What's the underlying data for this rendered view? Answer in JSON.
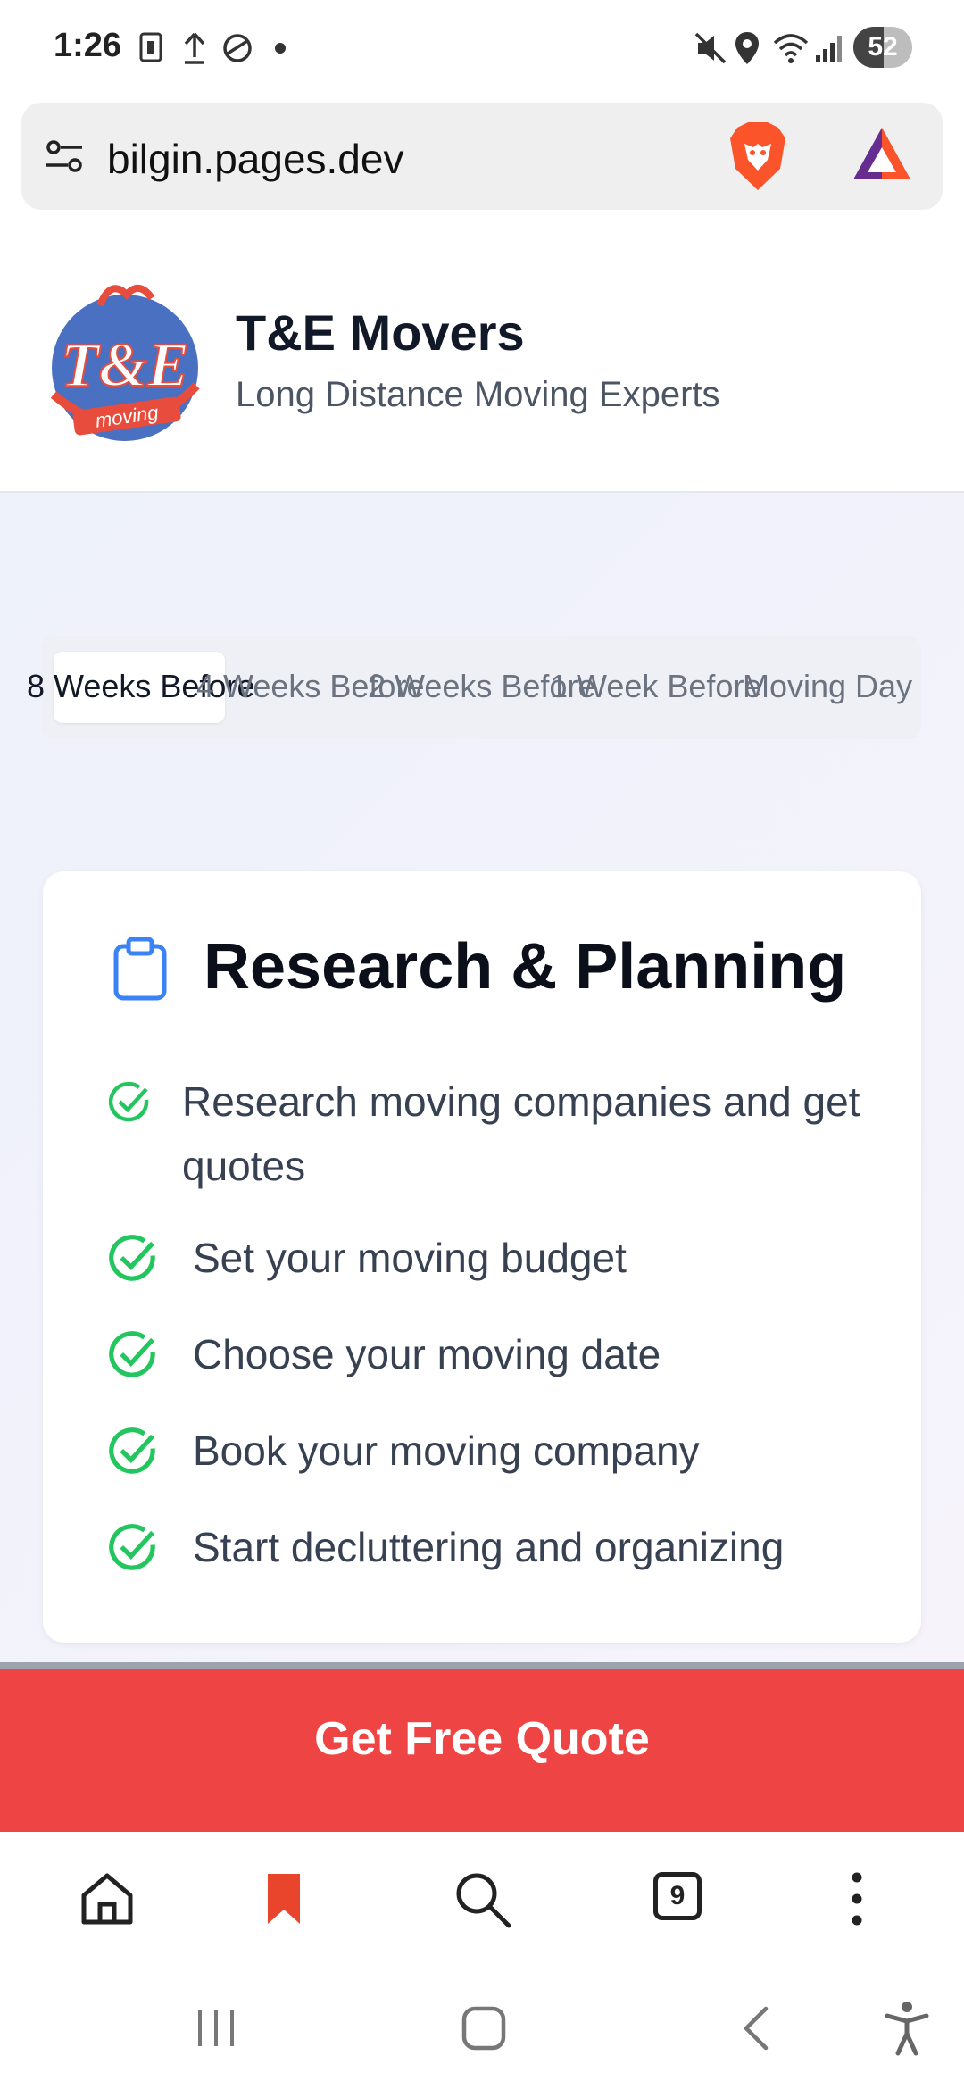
{
  "status_bar": {
    "time": "1:26",
    "battery": "52"
  },
  "browser": {
    "url": "bilgin.pages.dev",
    "tab_count": "9"
  },
  "site": {
    "brand": "T&E Movers",
    "tagline": "Long Distance Moving Experts",
    "logo_text": "T&E",
    "logo_subtext": "moving"
  },
  "timeline": {
    "tabs": [
      {
        "label": "8 Weeks Before",
        "active": true
      },
      {
        "label": "4 Weeks Before",
        "active": false
      },
      {
        "label": "2 Weeks Before",
        "active": false
      },
      {
        "label": "1 Week Before",
        "active": false
      },
      {
        "label": "Moving Day",
        "active": false
      }
    ]
  },
  "card": {
    "title": "Research & Planning",
    "icon": "clipboard-icon",
    "items": [
      "Research moving companies and get quotes",
      "Set your moving budget",
      "Choose your moving date",
      "Book your moving company",
      "Start decluttering and organizing"
    ]
  },
  "cta": {
    "label": "Get Free Quote"
  },
  "colors": {
    "accent_red": "#ef4444",
    "check_green": "#22c55e",
    "clipboard_blue": "#3b82f6",
    "brave_orange": "#fb542b"
  }
}
